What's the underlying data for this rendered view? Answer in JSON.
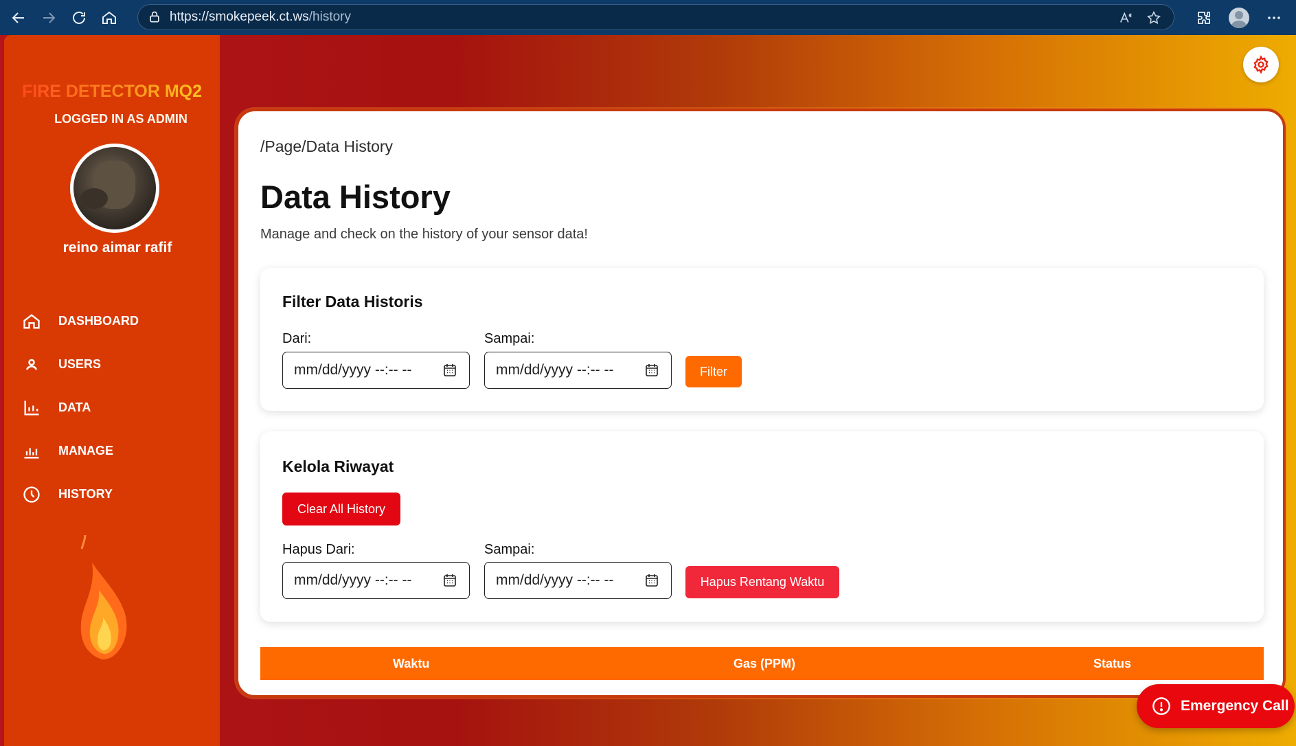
{
  "browser": {
    "url_host": "https://smokepeek.ct.ws",
    "url_path": "/history"
  },
  "sidebar": {
    "brand": "FIRE DETECTOR MQ2",
    "logged_in": "LOGGED IN AS ADMIN",
    "username": "reino aimar rafif",
    "items": [
      {
        "label": "DASHBOARD",
        "icon": "home-icon"
      },
      {
        "label": "USERS",
        "icon": "user-icon"
      },
      {
        "label": "DATA",
        "icon": "bar-chart-icon"
      },
      {
        "label": "MANAGE",
        "icon": "equalizer-icon"
      },
      {
        "label": "HISTORY",
        "icon": "clock-icon"
      }
    ]
  },
  "main": {
    "breadcrumb": "/Page/Data History",
    "title": "Data History",
    "subtitle": "Manage and check on the history of your sensor data!",
    "filter": {
      "title": "Filter Data Historis",
      "from_label": "Dari:",
      "to_label": "Sampai:",
      "from_value": "mm/dd/yyyy --:-- --",
      "to_value": "mm/dd/yyyy --:-- --",
      "button": "Filter"
    },
    "manage": {
      "title": "Kelola Riwayat",
      "clear_button": "Clear All History",
      "from_label": "Hapus Dari:",
      "to_label": "Sampai:",
      "from_value": "mm/dd/yyyy --:-- --",
      "to_value": "mm/dd/yyyy --:-- --",
      "delete_button": "Hapus Rentang Waktu"
    },
    "table": {
      "columns": [
        "Waktu",
        "Gas (PPM)",
        "Status"
      ]
    }
  },
  "emergency": {
    "label": "Emergency Call"
  },
  "colors": {
    "accent_orange": "#ff6a00",
    "danger_red": "#e30613",
    "sidebar_bg": "#d93a04"
  }
}
